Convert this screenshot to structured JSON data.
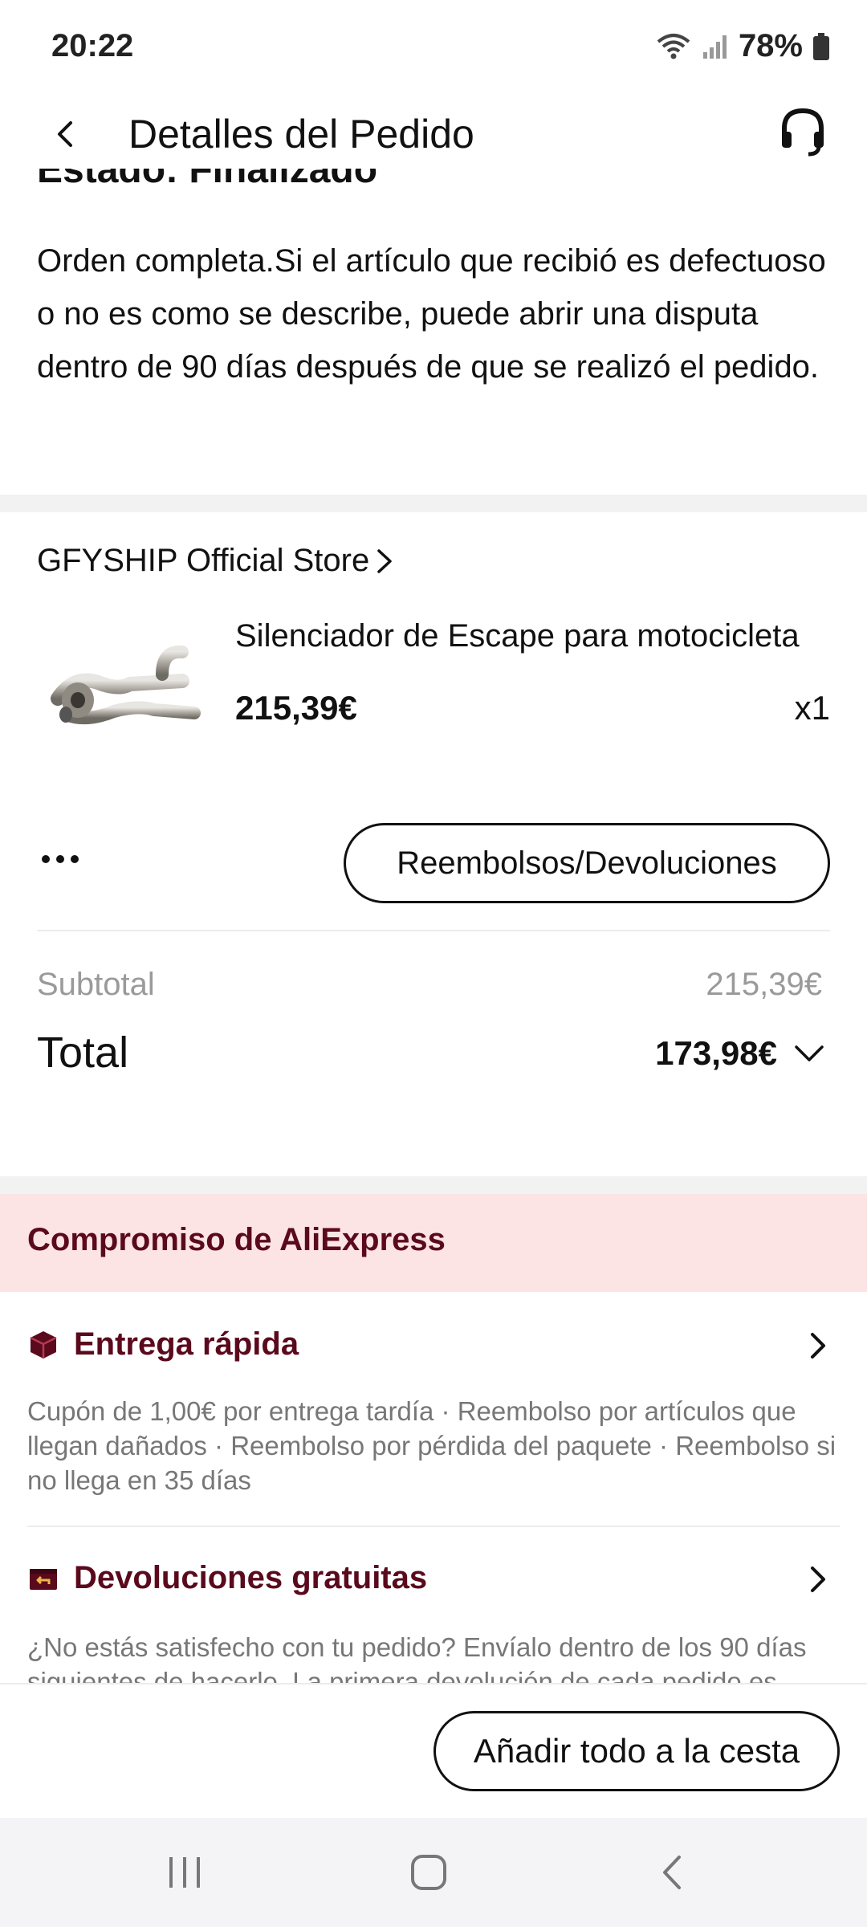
{
  "status_bar": {
    "time": "20:22",
    "battery": "78%",
    "icons": [
      "wifi-icon",
      "signal-icon",
      "battery-icon"
    ]
  },
  "header": {
    "title": "Detalles del Pedido",
    "back_icon": "back-arrow-icon",
    "support_icon": "headset-icon"
  },
  "order": {
    "status_partial": "Estado: Finalizado",
    "message": "Orden completa.Si el artículo que recibió es defectuoso o no es como se describe, puede abrir una disputa dentro de 90 días después de que se realizó el pedido."
  },
  "store": {
    "name": "GFYSHIP Official Store"
  },
  "product": {
    "title": "Silenciador de Escape para motocicleta",
    "price": "215,39€",
    "quantity": "x1",
    "image_icon": "exhaust-pipe-image"
  },
  "actions": {
    "more_icon": "more-dots-icon",
    "refund_label": "Reembolsos/Devoluciones"
  },
  "summary": {
    "subtotal_label": "Subtotal",
    "subtotal_value": "215,39€",
    "total_label": "Total",
    "total_value": "173,98€"
  },
  "commitment": {
    "title": "Compromiso de AliExpress",
    "items": [
      {
        "icon": "package-icon",
        "title": "Entrega rápida",
        "description": "Cupón de 1,00€ por entrega tardía · Reembolso por artículos que llegan dañados · Reembolso por pérdida del paquete · Reembolso si no llega en 35 días"
      },
      {
        "icon": "return-box-icon",
        "title": "Devoluciones gratuitas",
        "description": "¿No estás satisfecho con tu pedido? Envíalo dentro de los 90 días siguientes de hacerlo. La primera devolución de cada pedido es"
      }
    ]
  },
  "bottom": {
    "add_all_label": "Añadir todo a la cesta"
  },
  "colors": {
    "accent_dark": "#5a0a1c",
    "commit_band": "#fde4e4",
    "muted_text": "#9a9a9a"
  }
}
